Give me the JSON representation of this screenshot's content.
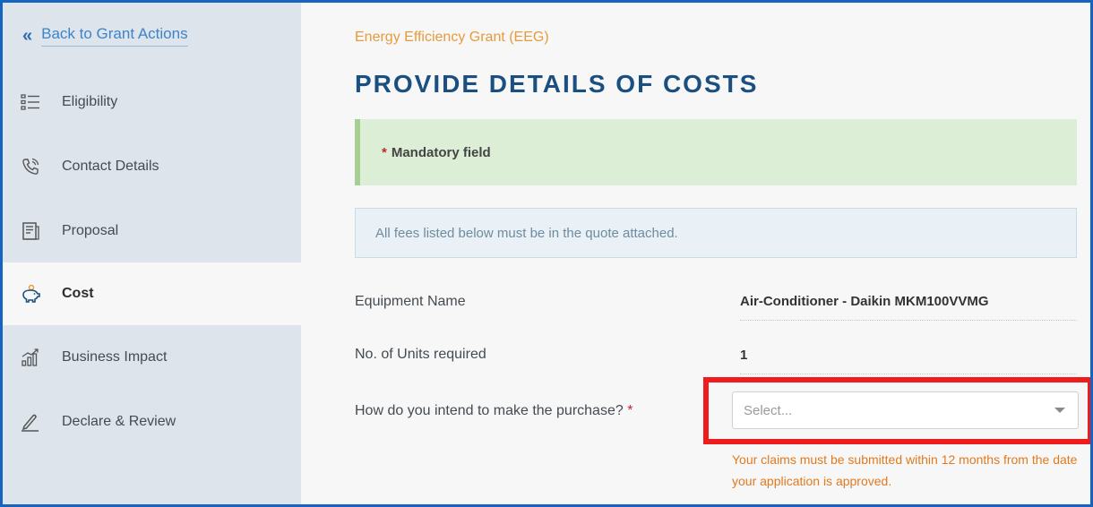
{
  "sidebar": {
    "back_label": "Back to Grant Actions",
    "items": [
      {
        "label": "Eligibility",
        "icon": "list-icon",
        "active": false
      },
      {
        "label": "Contact Details",
        "icon": "phone-icon",
        "active": false
      },
      {
        "label": "Proposal",
        "icon": "document-icon",
        "active": false
      },
      {
        "label": "Cost",
        "icon": "piggy-bank-icon",
        "active": true
      },
      {
        "label": "Business Impact",
        "icon": "chart-icon",
        "active": false
      },
      {
        "label": "Declare & Review",
        "icon": "pen-icon",
        "active": false
      }
    ]
  },
  "main": {
    "grant_name": "Energy Efficiency Grant (EEG)",
    "title": "PROVIDE DETAILS OF COSTS",
    "mandatory_note": "Mandatory field",
    "info_text": "All fees listed below must be in the quote attached.",
    "equipment_label": "Equipment Name",
    "equipment_value": "Air-Conditioner - Daikin MKM100VVMG",
    "units_label": "No. of Units required",
    "units_value": "1",
    "purchase_label": "How do you intend to make the purchase?",
    "purchase_placeholder": "Select...",
    "claim_note": "Your claims must be submitted within 12 months from the date your application is approved."
  },
  "colors": {
    "accent": "#1a4f80",
    "grant_orange": "#e79b3b",
    "highlight_red": "#ee1c1c",
    "frame_blue": "#1565c0"
  }
}
